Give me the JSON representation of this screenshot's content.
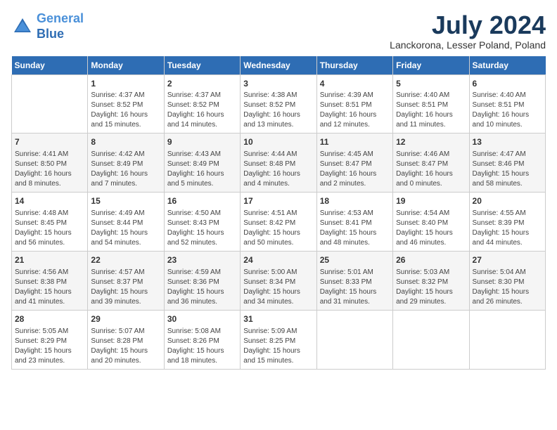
{
  "header": {
    "logo_line1": "General",
    "logo_line2": "Blue",
    "title": "July 2024",
    "location": "Lanckorona, Lesser Poland, Poland"
  },
  "days_of_week": [
    "Sunday",
    "Monday",
    "Tuesday",
    "Wednesday",
    "Thursday",
    "Friday",
    "Saturday"
  ],
  "weeks": [
    [
      {
        "day": "",
        "info": ""
      },
      {
        "day": "1",
        "info": "Sunrise: 4:37 AM\nSunset: 8:52 PM\nDaylight: 16 hours\nand 15 minutes."
      },
      {
        "day": "2",
        "info": "Sunrise: 4:37 AM\nSunset: 8:52 PM\nDaylight: 16 hours\nand 14 minutes."
      },
      {
        "day": "3",
        "info": "Sunrise: 4:38 AM\nSunset: 8:52 PM\nDaylight: 16 hours\nand 13 minutes."
      },
      {
        "day": "4",
        "info": "Sunrise: 4:39 AM\nSunset: 8:51 PM\nDaylight: 16 hours\nand 12 minutes."
      },
      {
        "day": "5",
        "info": "Sunrise: 4:40 AM\nSunset: 8:51 PM\nDaylight: 16 hours\nand 11 minutes."
      },
      {
        "day": "6",
        "info": "Sunrise: 4:40 AM\nSunset: 8:51 PM\nDaylight: 16 hours\nand 10 minutes."
      }
    ],
    [
      {
        "day": "7",
        "info": "Sunrise: 4:41 AM\nSunset: 8:50 PM\nDaylight: 16 hours\nand 8 minutes."
      },
      {
        "day": "8",
        "info": "Sunrise: 4:42 AM\nSunset: 8:49 PM\nDaylight: 16 hours\nand 7 minutes."
      },
      {
        "day": "9",
        "info": "Sunrise: 4:43 AM\nSunset: 8:49 PM\nDaylight: 16 hours\nand 5 minutes."
      },
      {
        "day": "10",
        "info": "Sunrise: 4:44 AM\nSunset: 8:48 PM\nDaylight: 16 hours\nand 4 minutes."
      },
      {
        "day": "11",
        "info": "Sunrise: 4:45 AM\nSunset: 8:47 PM\nDaylight: 16 hours\nand 2 minutes."
      },
      {
        "day": "12",
        "info": "Sunrise: 4:46 AM\nSunset: 8:47 PM\nDaylight: 16 hours\nand 0 minutes."
      },
      {
        "day": "13",
        "info": "Sunrise: 4:47 AM\nSunset: 8:46 PM\nDaylight: 15 hours\nand 58 minutes."
      }
    ],
    [
      {
        "day": "14",
        "info": "Sunrise: 4:48 AM\nSunset: 8:45 PM\nDaylight: 15 hours\nand 56 minutes."
      },
      {
        "day": "15",
        "info": "Sunrise: 4:49 AM\nSunset: 8:44 PM\nDaylight: 15 hours\nand 54 minutes."
      },
      {
        "day": "16",
        "info": "Sunrise: 4:50 AM\nSunset: 8:43 PM\nDaylight: 15 hours\nand 52 minutes."
      },
      {
        "day": "17",
        "info": "Sunrise: 4:51 AM\nSunset: 8:42 PM\nDaylight: 15 hours\nand 50 minutes."
      },
      {
        "day": "18",
        "info": "Sunrise: 4:53 AM\nSunset: 8:41 PM\nDaylight: 15 hours\nand 48 minutes."
      },
      {
        "day": "19",
        "info": "Sunrise: 4:54 AM\nSunset: 8:40 PM\nDaylight: 15 hours\nand 46 minutes."
      },
      {
        "day": "20",
        "info": "Sunrise: 4:55 AM\nSunset: 8:39 PM\nDaylight: 15 hours\nand 44 minutes."
      }
    ],
    [
      {
        "day": "21",
        "info": "Sunrise: 4:56 AM\nSunset: 8:38 PM\nDaylight: 15 hours\nand 41 minutes."
      },
      {
        "day": "22",
        "info": "Sunrise: 4:57 AM\nSunset: 8:37 PM\nDaylight: 15 hours\nand 39 minutes."
      },
      {
        "day": "23",
        "info": "Sunrise: 4:59 AM\nSunset: 8:36 PM\nDaylight: 15 hours\nand 36 minutes."
      },
      {
        "day": "24",
        "info": "Sunrise: 5:00 AM\nSunset: 8:34 PM\nDaylight: 15 hours\nand 34 minutes."
      },
      {
        "day": "25",
        "info": "Sunrise: 5:01 AM\nSunset: 8:33 PM\nDaylight: 15 hours\nand 31 minutes."
      },
      {
        "day": "26",
        "info": "Sunrise: 5:03 AM\nSunset: 8:32 PM\nDaylight: 15 hours\nand 29 minutes."
      },
      {
        "day": "27",
        "info": "Sunrise: 5:04 AM\nSunset: 8:30 PM\nDaylight: 15 hours\nand 26 minutes."
      }
    ],
    [
      {
        "day": "28",
        "info": "Sunrise: 5:05 AM\nSunset: 8:29 PM\nDaylight: 15 hours\nand 23 minutes."
      },
      {
        "day": "29",
        "info": "Sunrise: 5:07 AM\nSunset: 8:28 PM\nDaylight: 15 hours\nand 20 minutes."
      },
      {
        "day": "30",
        "info": "Sunrise: 5:08 AM\nSunset: 8:26 PM\nDaylight: 15 hours\nand 18 minutes."
      },
      {
        "day": "31",
        "info": "Sunrise: 5:09 AM\nSunset: 8:25 PM\nDaylight: 15 hours\nand 15 minutes."
      },
      {
        "day": "",
        "info": ""
      },
      {
        "day": "",
        "info": ""
      },
      {
        "day": "",
        "info": ""
      }
    ]
  ]
}
